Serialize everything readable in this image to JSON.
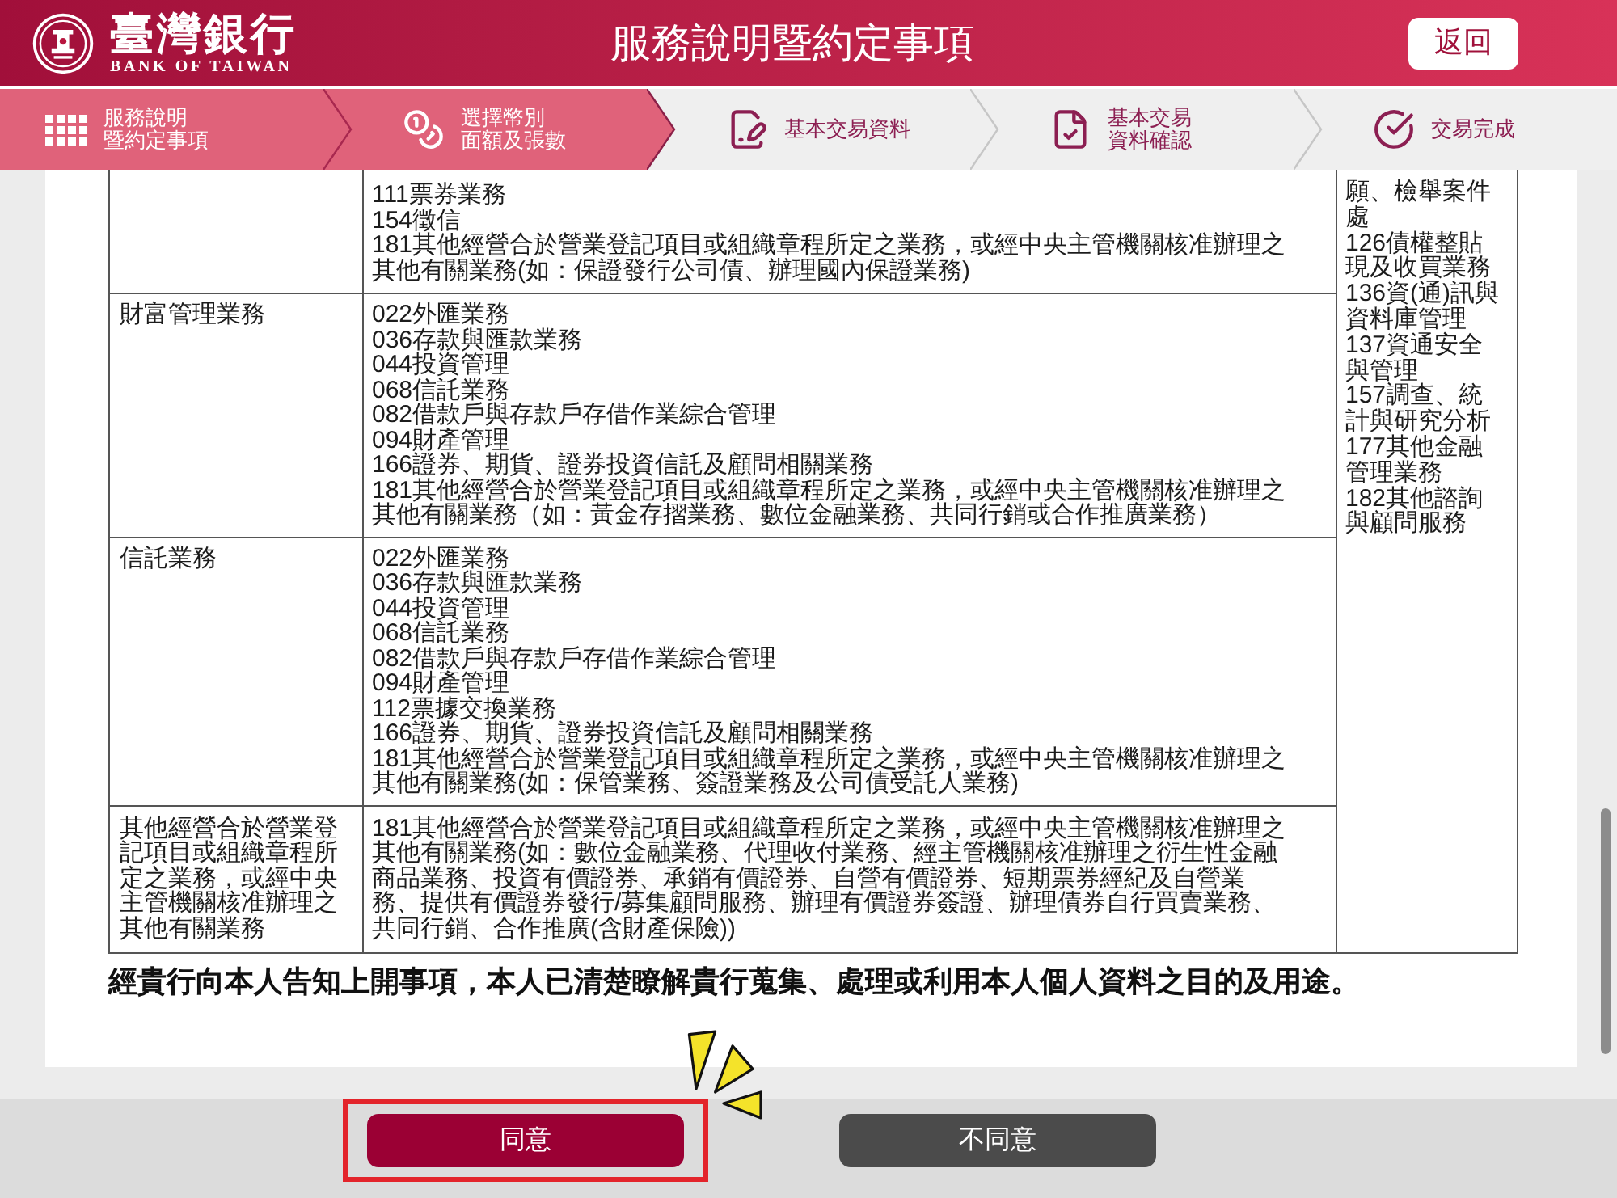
{
  "header": {
    "bank_name": "臺灣銀行",
    "bank_name_en": "BANK OF TAIWAN",
    "title": "服務說明暨約定事項",
    "back_button": "返回"
  },
  "steps": [
    {
      "label": [
        "服務說明",
        "暨約定事項"
      ],
      "active": true
    },
    {
      "label": [
        "選擇幣別",
        "面額及張數"
      ],
      "active": true
    },
    {
      "label": [
        "基本交易資料"
      ],
      "active": false
    },
    {
      "label": [
        "基本交易",
        "資料確認"
      ],
      "active": false
    },
    {
      "label": [
        "交易完成"
      ],
      "active": false
    }
  ],
  "table": {
    "rows": [
      {
        "items": [
          "111票券業務",
          "154徵信",
          "181其他經營合於營業登記項目或組織章程所定之業務，或經中央主管機關核准辦理之其他有關業務(如：保證發行公司債、辦理國內保證業務)"
        ]
      },
      {
        "category": "財富管理業務",
        "items": [
          "022外匯業務",
          "036存款與匯款業務",
          "044投資管理",
          "068信託業務",
          "082借款戶與存款戶存借作業綜合管理",
          "094財產管理",
          "166證券、期貨、證券投資信託及顧問相關業務",
          "181其他經營合於營業登記項目或組織章程所定之業務，或經中央主管機關核准辦理之其他有關業務（如：黃金存摺業務、數位金融業務、共同行銷或合作推廣業務）"
        ]
      },
      {
        "category": "信託業務",
        "items": [
          "022外匯業務",
          "036存款與匯款業務",
          "044投資管理",
          "068信託業務",
          "082借款戶與存款戶存借作業綜合管理",
          "094財產管理",
          "112票據交換業務",
          "166證券、期貨、證券投資信託及顧問相關業務",
          "181其他經營合於營業登記項目或組織章程所定之業務，或經中央主管機關核准辦理之其他有關業務(如：保管業務、簽證業務及公司債受託人業務)"
        ]
      },
      {
        "category": "其他經營合於營業登記項目或組織章程所定之業務，或經中央主管機關核准辦理之其他有關業務",
        "items": [
          "181其他經營合於營業登記項目或組織章程所定之業務，或經中央主管機關核准辦理之其他有關業務(如：數位金融業務、代理收付業務、經主管機關核准辦理之衍生性金融商品業務、投資有價證券、承銷有價證券、自營有價證券、短期票券經紀及自營業務、提供有價證券發行/募集顧問服務、辦理有價證券簽證、辦理債券自行買賣業務、共同行銷、合作推廣(含財產保險))"
        ]
      }
    ],
    "side_column": [
      "願、檢舉案件處",
      "126債權整貼現及收買業務",
      "136資(通)訊與資料庫管理",
      "137資通安全與管理",
      "157調查、統計與研究分析",
      "177其他金融管理業務",
      "182其他諮詢與顧問服務"
    ]
  },
  "statement": "經貴行向本人告知上開事項，本人已清楚瞭解貴行蒐集、處理或利用本人個人資料之目的及用途。",
  "buttons": [
    {
      "label": "同意",
      "kind": "primary",
      "highlighted": true
    },
    {
      "label": "不同意",
      "kind": "secondary",
      "highlighted": false
    }
  ]
}
